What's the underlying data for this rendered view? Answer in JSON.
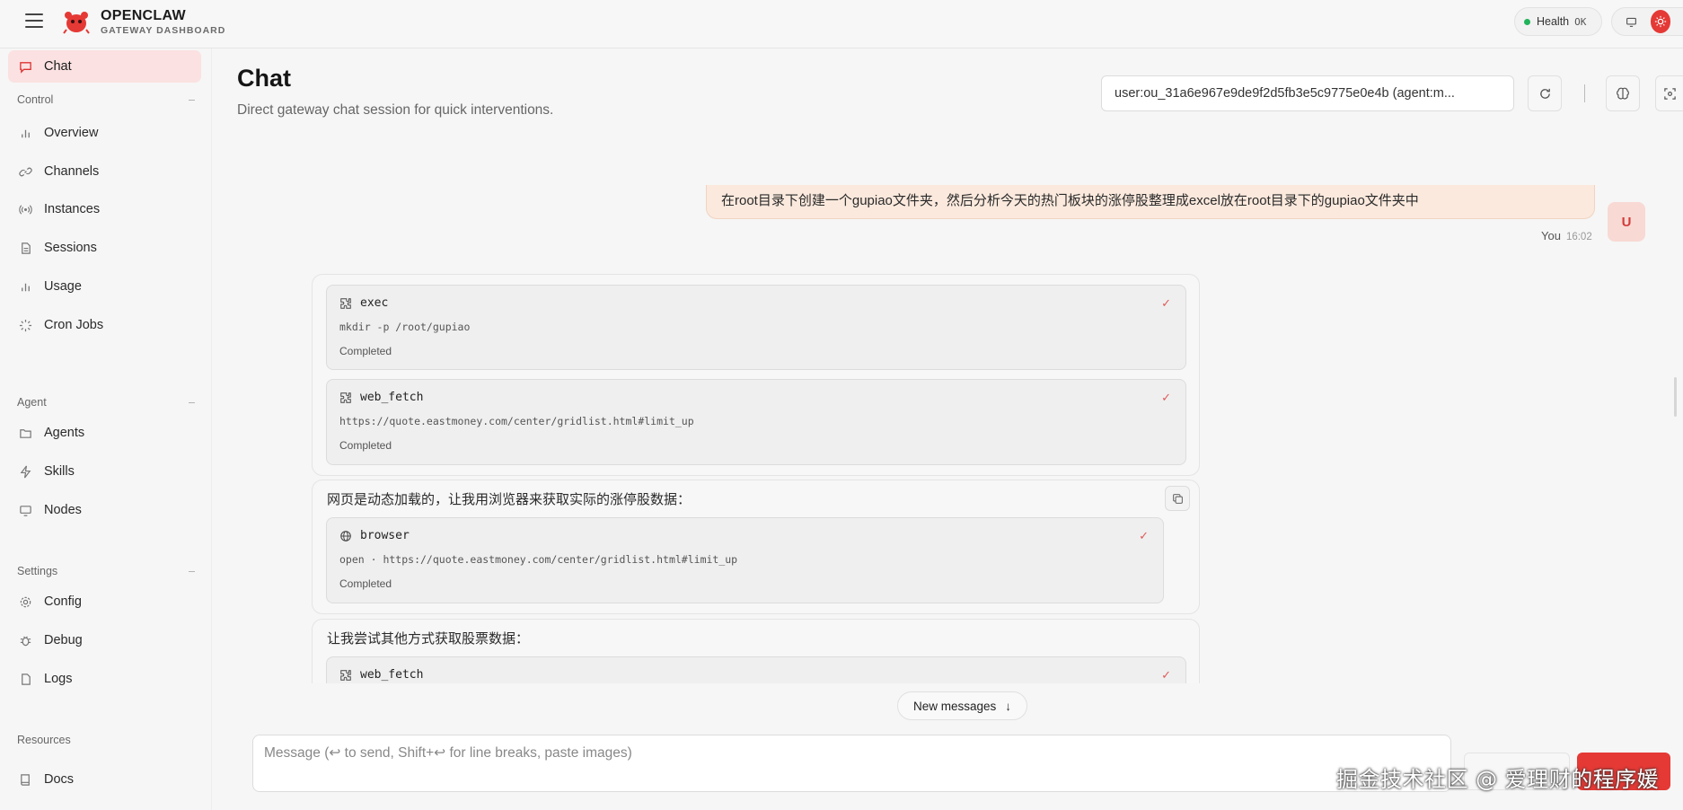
{
  "brand": {
    "title": "OPENCLAW",
    "subtitle": "GATEWAY DASHBOARD"
  },
  "health": {
    "label": "Health",
    "status": "OK"
  },
  "sidebar": {
    "chat": {
      "label": "Chat"
    },
    "control": {
      "heading": "Control",
      "collapse": "–",
      "items": [
        {
          "label": "Overview"
        },
        {
          "label": "Channels"
        },
        {
          "label": "Instances"
        },
        {
          "label": "Sessions"
        },
        {
          "label": "Usage"
        },
        {
          "label": "Cron Jobs"
        }
      ]
    },
    "agent": {
      "heading": "Agent",
      "collapse": "–",
      "items": [
        {
          "label": "Agents"
        },
        {
          "label": "Skills"
        },
        {
          "label": "Nodes"
        }
      ]
    },
    "settings": {
      "heading": "Settings",
      "collapse": "–",
      "items": [
        {
          "label": "Config"
        },
        {
          "label": "Debug"
        },
        {
          "label": "Logs"
        }
      ]
    },
    "resources": {
      "heading": "Resources",
      "items": [
        {
          "label": "Docs"
        }
      ]
    }
  },
  "header": {
    "title": "Chat",
    "subtitle": "Direct gateway chat session for quick interventions.",
    "session": "user:ou_31a6e967e9de9f2d5fb3e5c9775e0e4b (agent:m..."
  },
  "chat": {
    "user_message": "在root目录下创建一个gupiao文件夹，然后分析今天的热门板块的涨停股整理成excel放在root目录下的gupiao文件夹中",
    "user_name": "You",
    "user_time": "16:02",
    "user_avatar": "U",
    "group1": {
      "tools": [
        {
          "name": "exec",
          "detail": "mkdir -p /root/gupiao",
          "status": "Completed",
          "check": "✓"
        },
        {
          "name": "web_fetch",
          "detail": "https://quote.eastmoney.com/center/gridlist.html#limit_up",
          "status": "Completed",
          "check": "✓"
        }
      ]
    },
    "group2": {
      "text": "网页是动态加载的，让我用浏览器来获取实际的涨停股数据：",
      "tool": {
        "name": "browser",
        "detail": "open · https://quote.eastmoney.com/center/gridlist.html#limit_up",
        "status": "Completed",
        "check": "✓"
      }
    },
    "group3": {
      "text": "让我尝试其他方式获取股票数据：",
      "tool": {
        "name": "web_fetch",
        "check": "✓"
      }
    },
    "new_messages": "New messages",
    "new_messages_arrow": "↓"
  },
  "composer": {
    "placeholder": "Message (↩ to send, Shift+↩ for line breaks, paste images)"
  },
  "watermark": "掘金技术社区 @ 爱理财的程序媛",
  "colors": {
    "accent": "#e53935",
    "user_bubble": "#fbe9dd",
    "active_nav": "#fbe1e1"
  },
  "icons": {
    "menu": "hamburger-icon",
    "logo": "claw-logo",
    "chat": "chat-bubble-icon",
    "overview": "bar-chart-icon",
    "channels": "link-icon",
    "instances": "radio-icon",
    "sessions": "document-icon",
    "usage": "bar-chart-icon",
    "cron": "loader-icon",
    "agents": "folder-icon",
    "skills": "bolt-icon",
    "nodes": "monitor-icon",
    "config": "gear-icon",
    "debug": "bug-icon",
    "logs": "file-icon",
    "docs": "book-icon",
    "refresh": "refresh-icon",
    "brain": "brain-icon",
    "focus": "focus-icon",
    "tool": "puzzle-icon",
    "globe": "globe-icon",
    "copy": "copy-icon"
  }
}
